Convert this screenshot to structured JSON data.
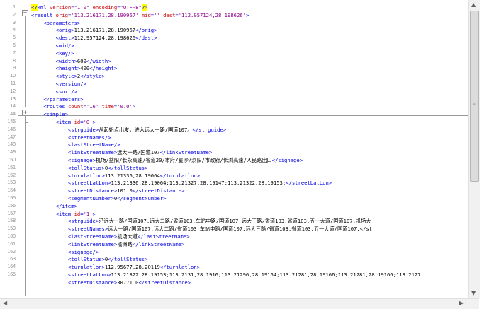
{
  "gutter": [
    "1",
    "2",
    "3",
    "4",
    "5",
    "6",
    "7",
    "8",
    "9",
    "10",
    "11",
    "12",
    "13",
    "14",
    "144",
    "145",
    "146",
    "147",
    "148",
    "149",
    "150",
    "151",
    "152",
    "153",
    "154",
    "155",
    "156",
    "157",
    "158",
    "159",
    "160",
    "161",
    "162",
    "163",
    "164",
    "165"
  ],
  "lines": [
    [
      [
        "pi",
        "<?"
      ],
      [
        "t",
        "xml "
      ],
      [
        "a",
        "version"
      ],
      [
        "t",
        "="
      ],
      [
        "v",
        "\"1.0\""
      ],
      [
        "t",
        " "
      ],
      [
        "a",
        "encoding"
      ],
      [
        "t",
        "="
      ],
      [
        "v",
        "\"UTF-8\""
      ],
      [
        "pi",
        "?>"
      ]
    ],
    [
      [
        "t",
        "<result "
      ],
      [
        "a",
        "orig"
      ],
      [
        "t",
        "="
      ],
      [
        "v",
        "'113.216171,28.190967'"
      ],
      [
        "t",
        " "
      ],
      [
        "a",
        "mid"
      ],
      [
        "t",
        "="
      ],
      [
        "v",
        "''"
      ],
      [
        "t",
        " "
      ],
      [
        "a",
        "dest"
      ],
      [
        "t",
        "="
      ],
      [
        "v",
        "'112.957124,28.198626'"
      ],
      [
        "t",
        ">"
      ]
    ],
    [
      [
        "tx",
        "    "
      ],
      [
        "t",
        "<parameters>"
      ]
    ],
    [
      [
        "tx",
        "        "
      ],
      [
        "t",
        "<orig>"
      ],
      [
        "tx",
        "113.216171,28.190967"
      ],
      [
        "t",
        "</orig>"
      ]
    ],
    [
      [
        "tx",
        "        "
      ],
      [
        "t",
        "<dest>"
      ],
      [
        "tx",
        "112.957124,28.198626"
      ],
      [
        "t",
        "</dest>"
      ]
    ],
    [
      [
        "tx",
        "        "
      ],
      [
        "t",
        "<mid/>"
      ]
    ],
    [
      [
        "tx",
        "        "
      ],
      [
        "t",
        "<key/>"
      ]
    ],
    [
      [
        "tx",
        "        "
      ],
      [
        "t",
        "<width>"
      ],
      [
        "tx",
        "600"
      ],
      [
        "t",
        "</width>"
      ]
    ],
    [
      [
        "tx",
        "        "
      ],
      [
        "t",
        "<height>"
      ],
      [
        "tx",
        "400"
      ],
      [
        "t",
        "</height>"
      ]
    ],
    [
      [
        "tx",
        "        "
      ],
      [
        "t",
        "<style>"
      ],
      [
        "tx",
        "2"
      ],
      [
        "t",
        "</style>"
      ]
    ],
    [
      [
        "tx",
        "        "
      ],
      [
        "t",
        "<version/>"
      ]
    ],
    [
      [
        "tx",
        "        "
      ],
      [
        "t",
        "<sort/>"
      ]
    ],
    [
      [
        "tx",
        "    "
      ],
      [
        "t",
        "</parameters>"
      ]
    ],
    [
      [
        "tx",
        "    "
      ],
      [
        "t",
        "<routes "
      ],
      [
        "a",
        "count"
      ],
      [
        "t",
        "="
      ],
      [
        "v",
        "'16'"
      ],
      [
        "t",
        " "
      ],
      [
        "a",
        "time"
      ],
      [
        "t",
        "="
      ],
      [
        "v",
        "'0.0'"
      ],
      [
        "t",
        ">"
      ]
    ],
    [
      [
        "tx",
        "    "
      ],
      [
        "t",
        "<simple>"
      ]
    ],
    [
      [
        "tx",
        "        "
      ],
      [
        "t",
        "<item "
      ],
      [
        "a",
        "id"
      ],
      [
        "t",
        "="
      ],
      [
        "v",
        "'0'"
      ],
      [
        "t",
        ">"
      ]
    ],
    [
      [
        "tx",
        "            "
      ],
      [
        "t",
        "<strguide>"
      ],
      [
        "tx",
        "从起始点出发，进入远大一路/国道107。"
      ],
      [
        "t",
        "</strguide>"
      ]
    ],
    [
      [
        "tx",
        "            "
      ],
      [
        "t",
        "<streetNames/>"
      ]
    ],
    [
      [
        "tx",
        "            "
      ],
      [
        "t",
        "<lastStreetName/>"
      ]
    ],
    [
      [
        "tx",
        "            "
      ],
      [
        "t",
        "<linkStreetName>"
      ],
      [
        "tx",
        "远大一路/国道107"
      ],
      [
        "t",
        "</linkStreetName>"
      ]
    ],
    [
      [
        "tx",
        "            "
      ],
      [
        "t",
        "<signage>"
      ],
      [
        "tx",
        "机场/益阳/长永高速/省道20/市府/星沙/浏阳/市政府/长浏高速/人民路出口"
      ],
      [
        "t",
        "</signage>"
      ]
    ],
    [
      [
        "tx",
        "            "
      ],
      [
        "t",
        "<tollStatus>"
      ],
      [
        "tx",
        "0"
      ],
      [
        "t",
        "</tollStatus>"
      ]
    ],
    [
      [
        "tx",
        "            "
      ],
      [
        "t",
        "<turnlatlon>"
      ],
      [
        "tx",
        "113.21336,28.19064"
      ],
      [
        "t",
        "</turnlatlon>"
      ]
    ],
    [
      [
        "tx",
        "            "
      ],
      [
        "t",
        "<streetLatLon>"
      ],
      [
        "tx",
        "113.21336,28.19064;113.21327,28.19147;113.21322,28.19153;"
      ],
      [
        "t",
        "</streetLatLon>"
      ]
    ],
    [
      [
        "tx",
        "            "
      ],
      [
        "t",
        "<streetDistance>"
      ],
      [
        "tx",
        "101.0"
      ],
      [
        "t",
        "</streetDistance>"
      ]
    ],
    [
      [
        "tx",
        "            "
      ],
      [
        "t",
        "<segmentNumber>"
      ],
      [
        "tx",
        "0"
      ],
      [
        "t",
        "</segmentNumber>"
      ]
    ],
    [
      [
        "tx",
        "        "
      ],
      [
        "t",
        "</item>"
      ]
    ],
    [
      [
        "tx",
        "        "
      ],
      [
        "t",
        "<item "
      ],
      [
        "a",
        "id"
      ],
      [
        "t",
        "="
      ],
      [
        "v",
        "'1'"
      ],
      [
        "t",
        ">"
      ]
    ],
    [
      [
        "tx",
        "            "
      ],
      [
        "t",
        "<strguide>"
      ],
      [
        "tx",
        "沿远大一路/国道107,远大二路/省道103,车站中路/国道107,远大三路/省道103,省道103,五一大道/国道107,机场大"
      ]
    ],
    [
      [
        "tx",
        "            "
      ],
      [
        "t",
        "<streetNames>"
      ],
      [
        "tx",
        "远大一路/国道107,远大二路/省道103,车站中路/国道107,远大三路/省道103,省道103,五一大道/国道107,</st"
      ]
    ],
    [
      [
        "tx",
        "            "
      ],
      [
        "t",
        "<lastStreetName>"
      ],
      [
        "tx",
        "机场大道"
      ],
      [
        "t",
        "</lastStreetName>"
      ]
    ],
    [
      [
        "tx",
        "            "
      ],
      [
        "t",
        "<linkStreetName>"
      ],
      [
        "tx",
        "橘洲路"
      ],
      [
        "t",
        "</linkStreetName>"
      ]
    ],
    [
      [
        "tx",
        "            "
      ],
      [
        "t",
        "<signage/>"
      ]
    ],
    [
      [
        "tx",
        "            "
      ],
      [
        "t",
        "<tollStatus>"
      ],
      [
        "tx",
        "0"
      ],
      [
        "t",
        "</tollStatus>"
      ]
    ],
    [
      [
        "tx",
        "            "
      ],
      [
        "t",
        "<turnlatlon>"
      ],
      [
        "tx",
        "112.95677,28.20119"
      ],
      [
        "t",
        "</turnlatlon>"
      ]
    ],
    [
      [
        "tx",
        "            "
      ],
      [
        "t",
        "<streetLatLon>"
      ],
      [
        "tx",
        "113.21322,28.19153;113.2131,28.1916;113.21296,28.19164;113.21281,28.19166;113.21281,28.19166;113.2127"
      ]
    ],
    [
      [
        "tx",
        "            "
      ],
      [
        "t",
        "<streetDistance>"
      ],
      [
        "tx",
        "30771.0"
      ],
      [
        "t",
        "</streetDistance>"
      ]
    ]
  ]
}
